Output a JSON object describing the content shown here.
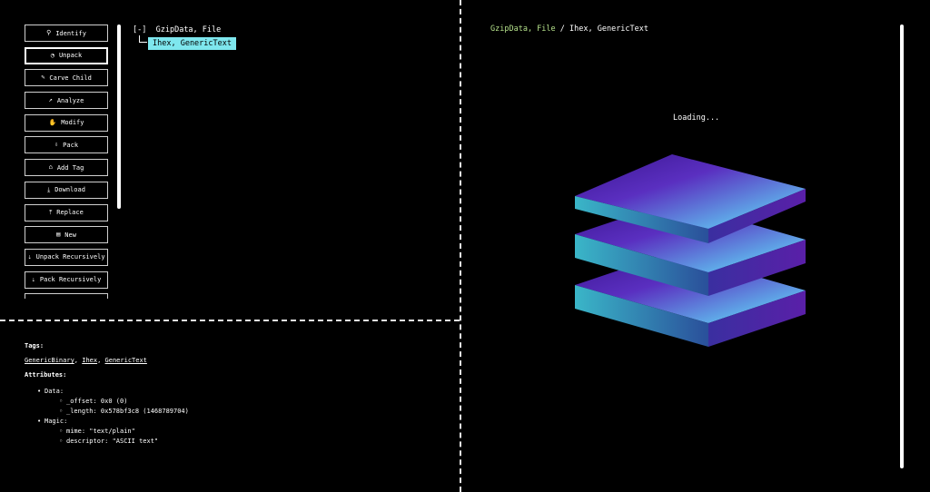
{
  "actions": [
    {
      "label": "Identify",
      "icon": "⚲"
    },
    {
      "label": "Unpack",
      "icon": "◔"
    },
    {
      "label": "Carve Child",
      "icon": "✎"
    },
    {
      "label": "Analyze",
      "icon": "↗"
    },
    {
      "label": "Modify",
      "icon": "✋"
    },
    {
      "label": "Pack",
      "icon": "⇩"
    },
    {
      "label": "Add Tag",
      "icon": "⌂"
    },
    {
      "label": "Download",
      "icon": "⤓"
    },
    {
      "label": "Replace",
      "icon": "⤒"
    },
    {
      "label": "New",
      "icon": "▤"
    },
    {
      "label": "Unpack Recursively",
      "icon": "⇣"
    },
    {
      "label": "Pack Recursively",
      "icon": "⇣"
    }
  ],
  "tree": {
    "toggle": "[-]",
    "root_label": "GzipData, File",
    "child_label": "Ihex, GenericText"
  },
  "details": {
    "tags_header": "Tags:",
    "tags": [
      "GenericBinary",
      "Ihex",
      "GenericText"
    ],
    "attributes_header": "Attributes:",
    "attributes": [
      {
        "name": "Data:",
        "items": [
          "_offset: 0x0 (0)",
          "_length: 0x578bf3c8 (1468789704)"
        ]
      },
      {
        "name": "Magic:",
        "items": [
          "mime: \"text/plain\"",
          "descriptor: \"ASCII text\""
        ]
      }
    ]
  },
  "breadcrumb": {
    "parent": "GzipData, File",
    "separator": " / ",
    "current": "Ihex, GenericText"
  },
  "loading_text": "Loading...",
  "colors": {
    "highlight": "#7ee7ee",
    "breadcrumb_link": "#b4e08a",
    "layer_top_dark": "#4b1fa0",
    "layer_top_light": "#62f0ff"
  }
}
